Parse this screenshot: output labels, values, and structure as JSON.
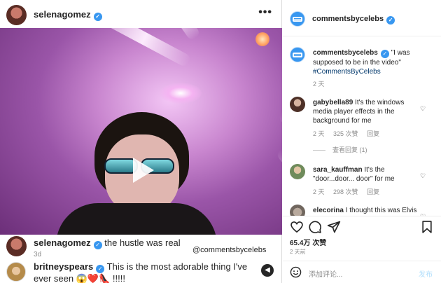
{
  "post": {
    "username": "selenagomez",
    "more_icon": "•••",
    "caption": {
      "username": "selenagomez",
      "text": "the hustle was real",
      "time": "3d"
    },
    "watermark": "@commentsbycelebs",
    "top_comment": {
      "username": "britneyspears",
      "text": "This is the most adorable thing I've ever seen 😱❤️👠 !!!!!"
    }
  },
  "sidebar": {
    "account": "commentsbycelebs",
    "caption": {
      "username": "commentsbycelebs",
      "text": "\"I was supposed to be in the video\"",
      "hashtag": "#CommentsByCelebs",
      "time": "2 天"
    },
    "comments": [
      {
        "username": "gabybella89",
        "text": "It's the windows media player effects in the background for me",
        "time": "2 天",
        "likes": "325 次赞",
        "reply": "回复",
        "view_replies": "查看回复 (1)"
      },
      {
        "username": "sara_kauffman",
        "text": "It's the \"door...door... door\" for me",
        "time": "2 天",
        "likes": "298 次赞",
        "reply": "回复"
      },
      {
        "username": "elecorina",
        "text": "I thought this was Elvis"
      }
    ],
    "likes": "65.4万 次赞",
    "posted_time": "2 天前",
    "comment_placeholder": "添加评论...",
    "post_button": "发布"
  },
  "colors": {
    "verified": "#3897f0",
    "link": "#00376b",
    "muted": "#8e8e8e",
    "post_disabled": "#b2dffc"
  }
}
